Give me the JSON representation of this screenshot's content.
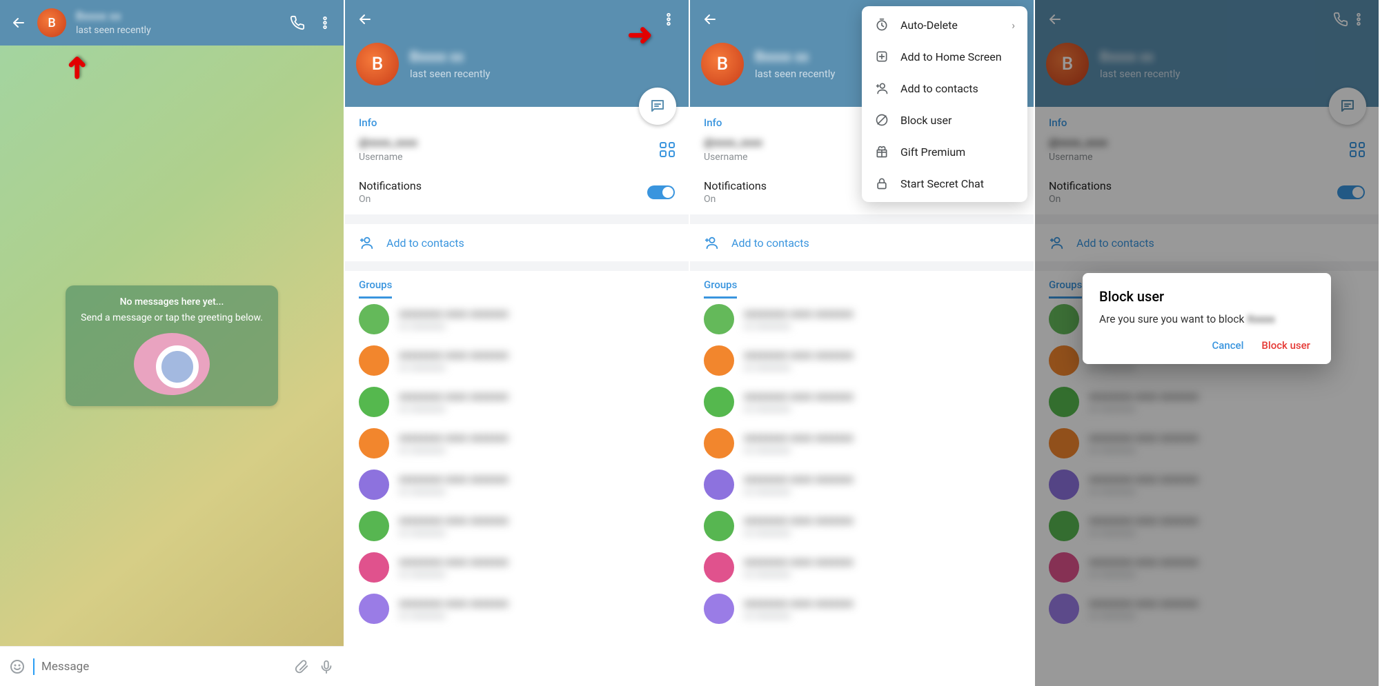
{
  "colors": {
    "accent": "#3a95de",
    "header": "#5a8fb0",
    "danger": "#e53935",
    "avatar": "#e96a3e"
  },
  "user": {
    "initial": "B",
    "name_masked": "Bxxxx xx",
    "status": "last seen recently",
    "username_masked": "@xxxx_xxxx",
    "username_label": "Username"
  },
  "chat": {
    "greeting_title": "No messages here yet...",
    "greeting_sub": "Send a message or tap\nthe greeting below.",
    "input_placeholder": "Message"
  },
  "profile": {
    "info_label": "Info",
    "notifications_label": "Notifications",
    "notifications_value": "On",
    "add_contacts": "Add to contacts",
    "groups_tab": "Groups"
  },
  "groups": [
    {
      "color": "#64b95a"
    },
    {
      "color": "#f2862d"
    },
    {
      "color": "#55b84e"
    },
    {
      "color": "#f2862d"
    },
    {
      "color": "#8d72de"
    },
    {
      "color": "#57b651"
    },
    {
      "color": "#e0528d"
    },
    {
      "color": "#9a7ce6"
    }
  ],
  "menu": {
    "auto_delete": "Auto-Delete",
    "home_screen": "Add to Home Screen",
    "add_contacts": "Add to contacts",
    "block": "Block user",
    "gift": "Gift Premium",
    "secret": "Start Secret Chat"
  },
  "dialog": {
    "title": "Block user",
    "message": "Are you sure you want to block",
    "target_masked": "Xxxxx",
    "cancel": "Cancel",
    "confirm": "Block user"
  }
}
